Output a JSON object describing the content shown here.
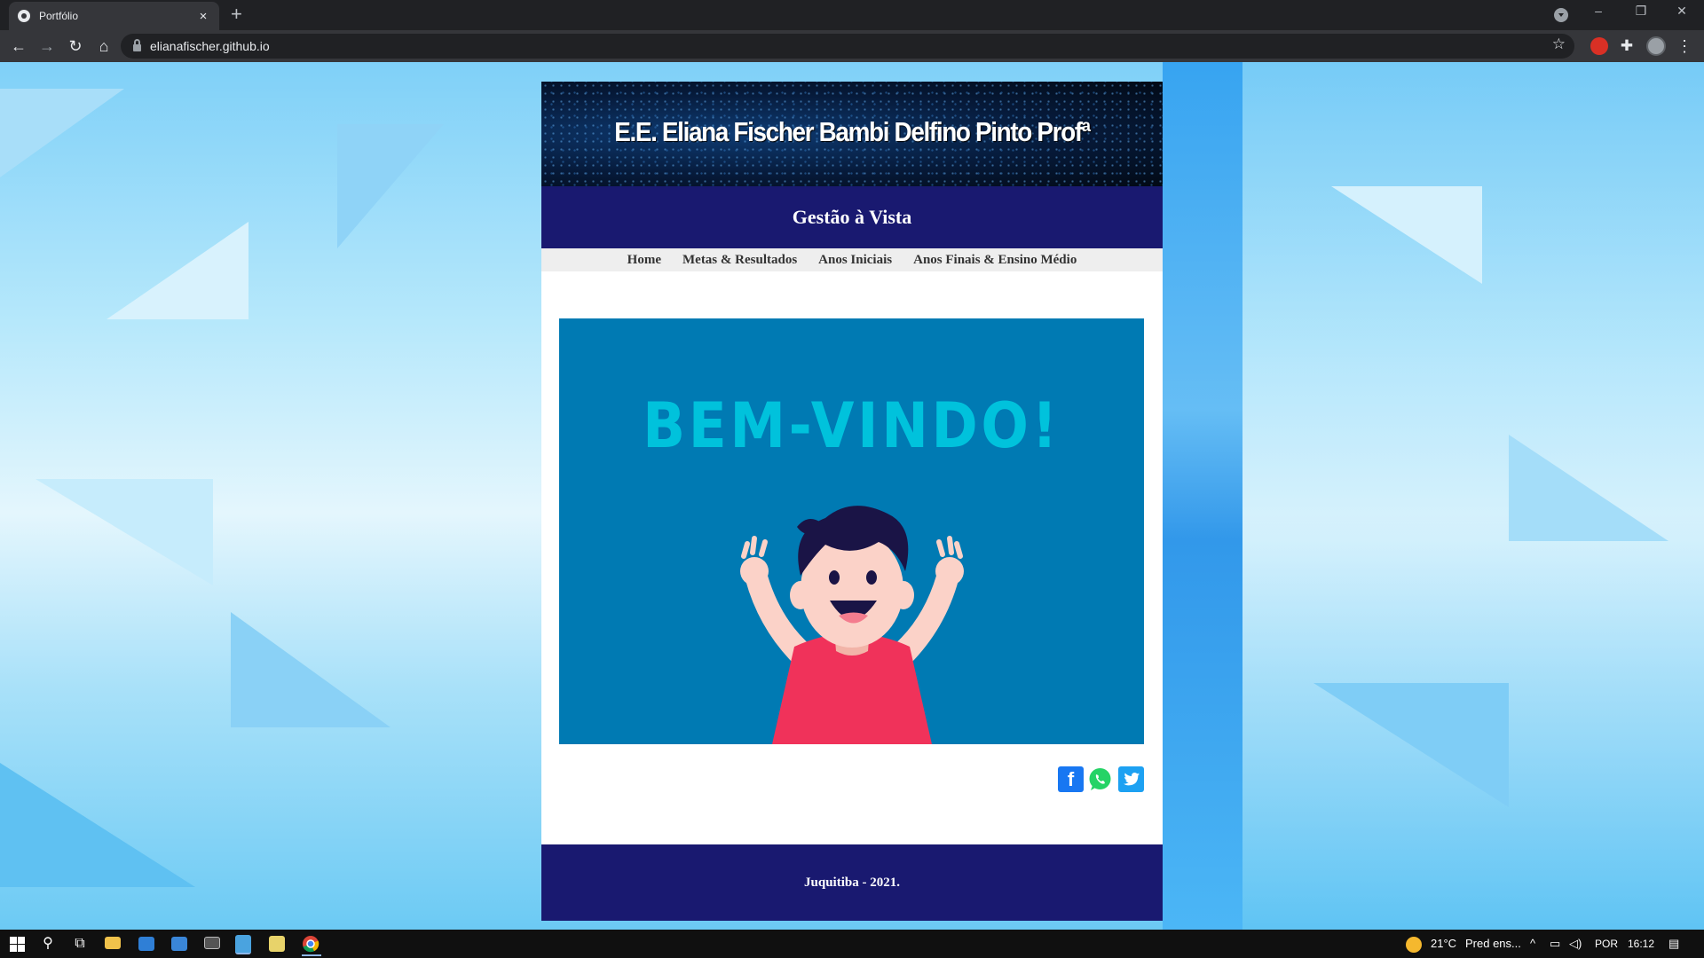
{
  "browser": {
    "tab_title": "Portfólio",
    "tab_close": "×",
    "new_tab": "+",
    "url": "elianafischer.github.io",
    "win_minimize": "–",
    "win_restore": "❐",
    "win_close": "✕",
    "icons": {
      "back": "←",
      "forward": "→",
      "reload": "↻",
      "home": "⌂",
      "bookmark": "☆",
      "extensions": "✚",
      "menu": "⋮"
    }
  },
  "site": {
    "hero_title": "E.E. Eliana Fischer Bambi Delfino Pinto Profª",
    "subtitle": "Gestão à Vista",
    "nav": [
      {
        "label": "Home"
      },
      {
        "label": "Metas & Resultados"
      },
      {
        "label": "Anos Iniciais"
      },
      {
        "label": "Anos Finais & Ensino Médio"
      }
    ],
    "welcome_text": "BEM-VINDO!",
    "share": {
      "facebook_glyph": "f"
    },
    "footer": "Juquitiba - 2021."
  },
  "taskbar": {
    "weather_temp": "21°C",
    "weather_desc": "Pred ens...",
    "language": "POR",
    "time": "16:12"
  },
  "colors": {
    "navy": "#191970",
    "welcome_bg": "#007ab3",
    "welcome_text": "#00c2dc",
    "shirt": "#f0325a",
    "facebook": "#1877f2",
    "whatsapp": "#25d366",
    "twitter": "#1da1f2"
  }
}
